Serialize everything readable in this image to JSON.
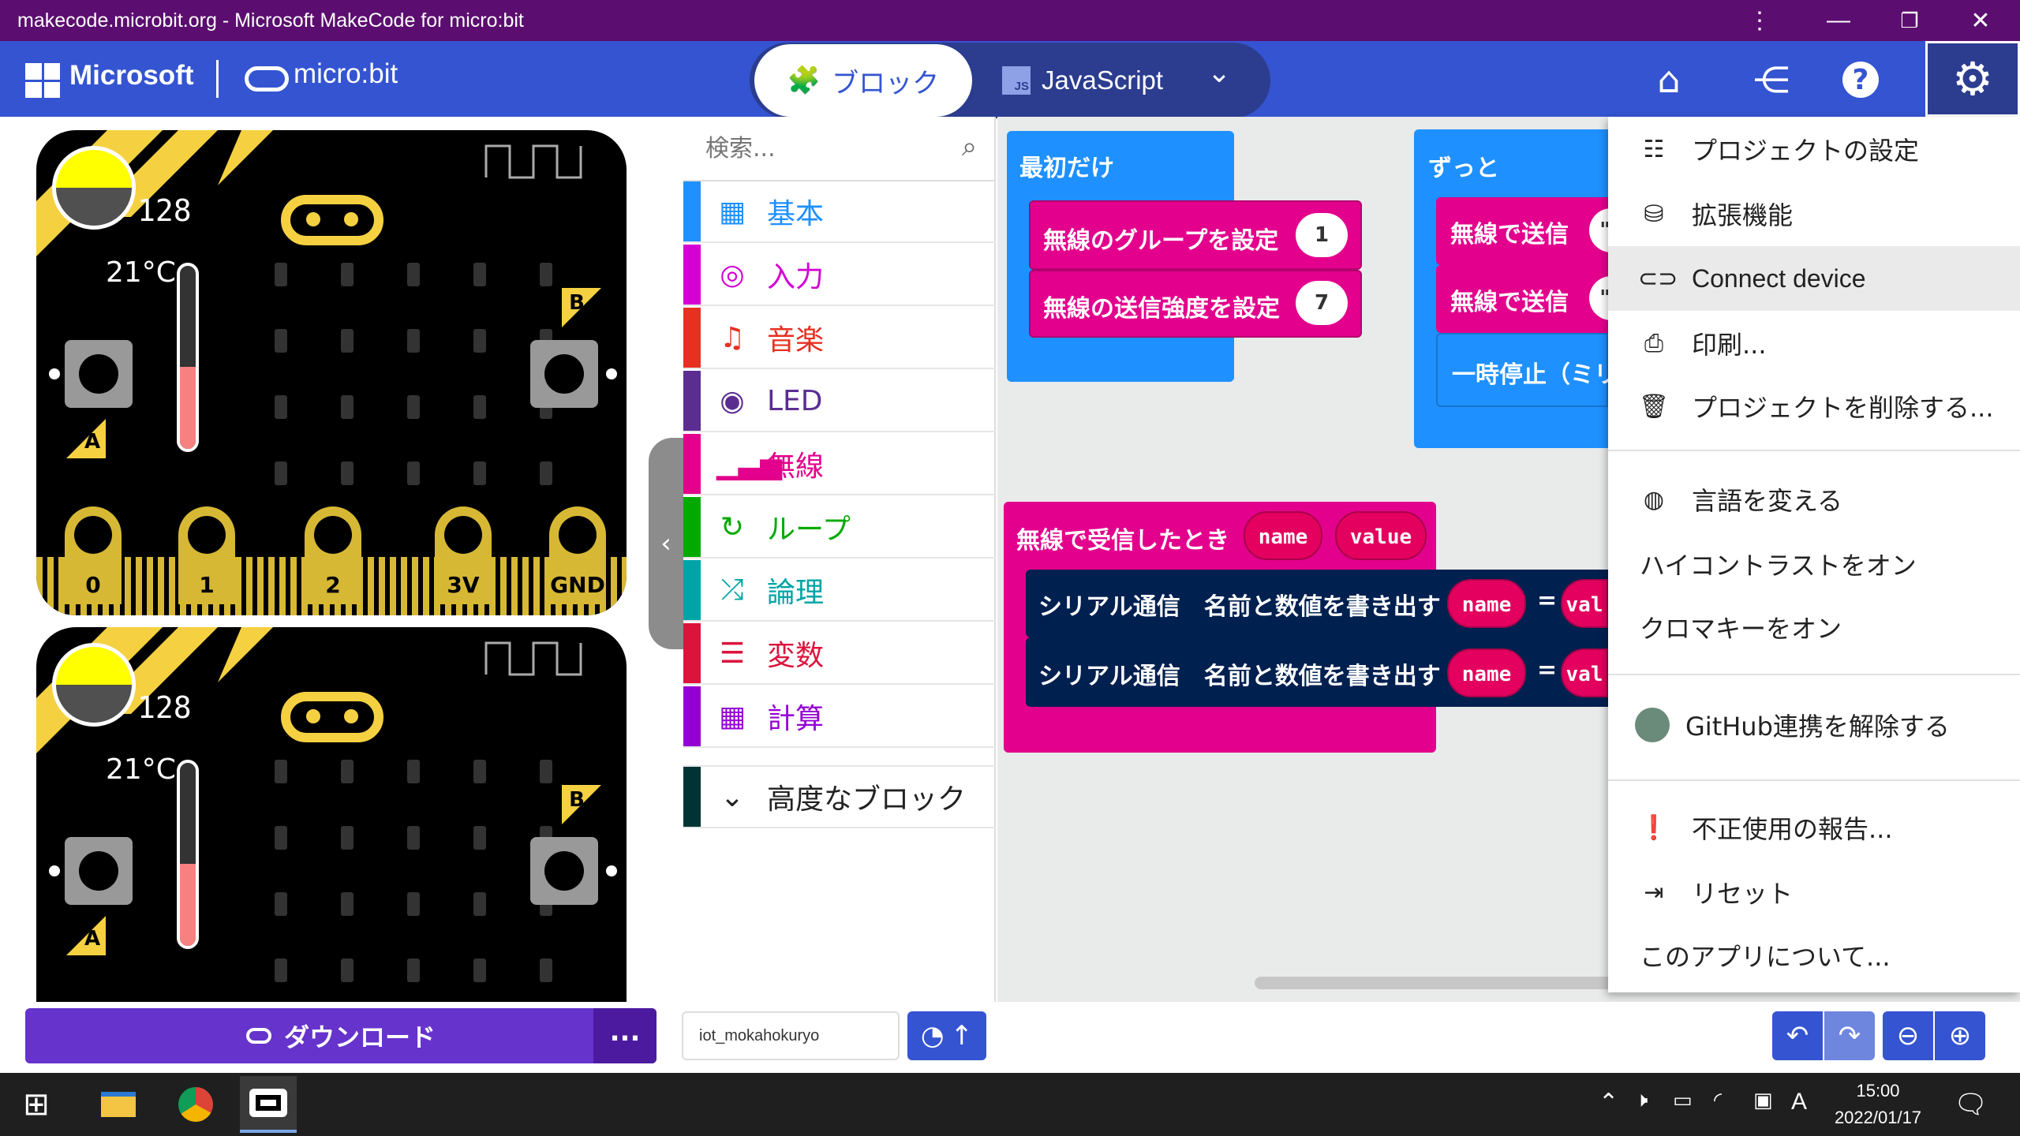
{
  "window": {
    "title": "makecode.microbit.org - Microsoft MakeCode for micro:bit"
  },
  "header": {
    "brand": "Microsoft",
    "product": "micro:bit",
    "tabs": [
      {
        "label": "ブロック"
      },
      {
        "label": "JavaScript"
      }
    ],
    "icons": [
      "home-icon",
      "share-icon",
      "help-icon",
      "settings-icon"
    ]
  },
  "simulators": [
    {
      "light_level": "128",
      "temperature": "21°C",
      "pins": [
        "0",
        "1",
        "2",
        "3V",
        "GND"
      ],
      "button_a": "A",
      "button_b": "B"
    },
    {
      "light_level": "128",
      "temperature": "21°C",
      "button_a": "A",
      "button_b": "B"
    }
  ],
  "toolbox": {
    "search_placeholder": "検索...",
    "categories": [
      {
        "label": "基本",
        "color": "#1e90ff"
      },
      {
        "label": "入力",
        "color": "#d400d4"
      },
      {
        "label": "音楽",
        "color": "#e63022"
      },
      {
        "label": "LED",
        "color": "#5c2d91"
      },
      {
        "label": "無線",
        "color": "#e3008c"
      },
      {
        "label": "ループ",
        "color": "#00aa00"
      },
      {
        "label": "論理",
        "color": "#00a4a6"
      },
      {
        "label": "変数",
        "color": "#dc143c"
      },
      {
        "label": "計算",
        "color": "#9400d3"
      }
    ],
    "advanced": "高度なブロック"
  },
  "workspace": {
    "on_start": {
      "label": "最初だけ",
      "set_group": "無線のグループを設定",
      "group_value": "1",
      "set_power": "無線の送信強度を設定",
      "power_value": "7"
    },
    "forever": {
      "label": "ずっと",
      "send1": "無線で送信",
      "send2": "無線で送信",
      "pause": "一時停止（ミリ"
    },
    "on_received": {
      "label": "無線で受信したとき",
      "param1": "name",
      "param2": "value"
    },
    "serial_rows": [
      {
        "label": "シリアル通信　名前と数値を書き出す",
        "name": "name",
        "eq": "=",
        "val": "val"
      },
      {
        "label": "シリアル通信　名前と数値を書き出す",
        "name": "name",
        "eq": "=",
        "val": "val"
      }
    ]
  },
  "settings_menu": {
    "items": [
      {
        "label": "プロジェクトの設定",
        "icon": "sliders-icon"
      },
      {
        "label": "拡張機能",
        "icon": "drive-icon"
      },
      {
        "label": "Connect device",
        "icon": "link-icon"
      },
      {
        "label": "印刷...",
        "icon": "print-icon"
      },
      {
        "label": "プロジェクトを削除する...",
        "icon": "trash-icon"
      },
      {
        "label": "言語を変える",
        "icon": "globe-icon"
      },
      {
        "label": "ハイコントラストをオン"
      },
      {
        "label": "クロマキーをオン"
      },
      {
        "label": "GitHub連携を解除する",
        "icon": "github-avatar-icon"
      },
      {
        "label": "不正使用の報告...",
        "icon": "alert-icon"
      },
      {
        "label": "リセット",
        "icon": "signout-icon"
      },
      {
        "label": "このアプリについて..."
      }
    ]
  },
  "footer": {
    "download": "ダウンロード",
    "more": "...",
    "project_name": "iot_mokahokuryo"
  },
  "taskbar": {
    "time": "15:00",
    "date": "2022/01/17",
    "ime": "A"
  }
}
